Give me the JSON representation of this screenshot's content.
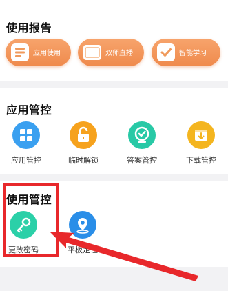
{
  "report": {
    "title": "使用报告",
    "buttons": [
      {
        "label": "应用使用",
        "icon": "report-doc-icon"
      },
      {
        "label": "双师直播",
        "icon": "live-card-icon"
      },
      {
        "label": "智能学习",
        "icon": "check-box-icon"
      }
    ]
  },
  "app_control": {
    "title": "应用管控",
    "items": [
      {
        "label": "应用管控",
        "icon": "grid-apps-icon",
        "color": "#3aa0f0"
      },
      {
        "label": "临时解锁",
        "icon": "unlock-icon",
        "color": "#f6a21d"
      },
      {
        "label": "答案管控",
        "icon": "shield-check-icon",
        "color": "#28c9a6"
      },
      {
        "label": "下载管控",
        "icon": "download-icon",
        "color": "#f4b51f"
      }
    ]
  },
  "usage_control": {
    "title": "使用管控",
    "items": [
      {
        "label": "更改密码",
        "icon": "key-icon",
        "color": "#2bd0a8"
      },
      {
        "label": "平板定位",
        "icon": "location-pin-icon",
        "color": "#2a8ee8"
      }
    ]
  },
  "annotation": {
    "color": "#e8282b"
  }
}
